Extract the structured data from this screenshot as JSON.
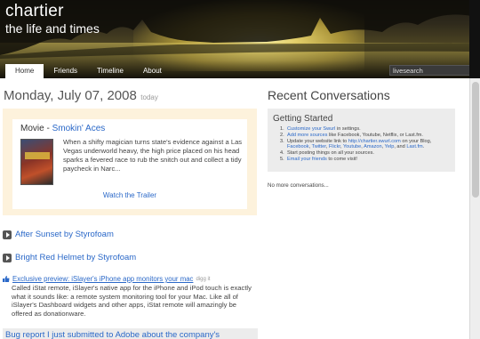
{
  "header": {
    "site_title": "chartier",
    "site_subtitle": "the life and times",
    "tabs": [
      {
        "label": "Home"
      },
      {
        "label": "Friends"
      },
      {
        "label": "Timeline"
      },
      {
        "label": "About"
      }
    ],
    "search": {
      "value": "livesearch"
    }
  },
  "main": {
    "date": "Monday, July 07, 2008",
    "date_suffix": "today",
    "movie": {
      "prefix": "Movie - ",
      "title": "Smokin' Aces",
      "description": "When a shifty magician turns state's evidence against a Las Vegas underworld heavy, the high price placed on his head sparks a fevered race to rub the snitch out and collect a tidy paycheck in Narc...",
      "trailer_label": "Watch the Trailer"
    },
    "music": [
      {
        "title": "After Sunset by Styrofoam"
      },
      {
        "title": "Bright Red Helmet by Styrofoam"
      }
    ],
    "digg": {
      "title": "Exclusive preview: iSlayer's iPhone app monitors your mac",
      "source": "digg it",
      "body": "Called iStat remote, iSlayer's native app for the iPhone and iPod touch is exactly what it sounds like: a remote system monitoring tool for your Mac. Like all of iSlayer's Dashboard widgets and other apps, iStat remote will amazingly be offered as donationware."
    },
    "bug_report": "Bug report I just submitted to Adobe about the company's"
  },
  "sidebar": {
    "title": "Recent Conversations",
    "getting_started": {
      "title": "Getting Started",
      "steps": {
        "s1_link": "Customize your Swurl",
        "s1_rest": " in settings.",
        "s2_link": "Add more sources",
        "s2_rest": " like Facebook, Youtube, Netflix, or Last.fm.",
        "s3_pre": "Update your website link to ",
        "s3_link": "http://chartier.swurl.com",
        "s3_mid": " on your Blog,",
        "s3_l1": "Facebook",
        "s3_l2": "Twitter",
        "s3_l3": "Flickr",
        "s3_l4": "Youtube",
        "s3_l5": "Amazon",
        "s3_l6": "Yelp",
        "s3_and": ", and ",
        "s3_l7": "Last.fm",
        "s4": "Start posting things on all your sources.",
        "s5_link": "Email your friends",
        "s5_rest": " to come visit!"
      }
    },
    "no_more": "No more conversations..."
  },
  "colors": {
    "link": "#2a68c8",
    "movie_card_bg": "#fdf2dc",
    "panel_bg": "#ececec"
  }
}
